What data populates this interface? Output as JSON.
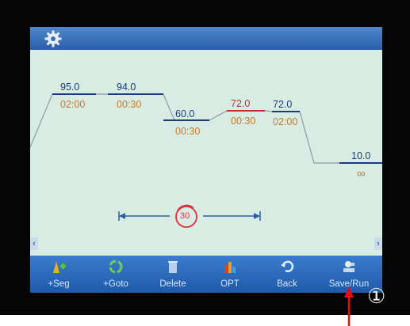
{
  "program": {
    "steps": [
      {
        "temp": "95.0",
        "time": "02:00",
        "color": "#1a3d7a"
      },
      {
        "temp": "94.0",
        "time": "00:30",
        "color": "#1a3d7a"
      },
      {
        "temp": "60.0",
        "time": "00:30",
        "color": "#1a3d7a"
      },
      {
        "temp": "72.0",
        "time": "00:30",
        "color": "#c03030"
      },
      {
        "temp": "72.0",
        "time": "02:00",
        "color": "#1a3d7a"
      },
      {
        "temp": "10.0",
        "time": "∞",
        "color": "#1a3d7a"
      }
    ],
    "cycles": "30"
  },
  "nav": {
    "left": "‹",
    "right": "›"
  },
  "toolbar": {
    "add_segment": "+Seg",
    "add_goto": "+Goto",
    "delete": "Delete",
    "opt": "OPT",
    "back": "Back",
    "save_run": "Save/Run"
  },
  "annotation": {
    "marker": "①"
  },
  "colors": {
    "screen": "#d9ece3",
    "toolbar": "#2f6dbd",
    "accent_red": "#e03040",
    "time_text": "#c87a2a"
  }
}
